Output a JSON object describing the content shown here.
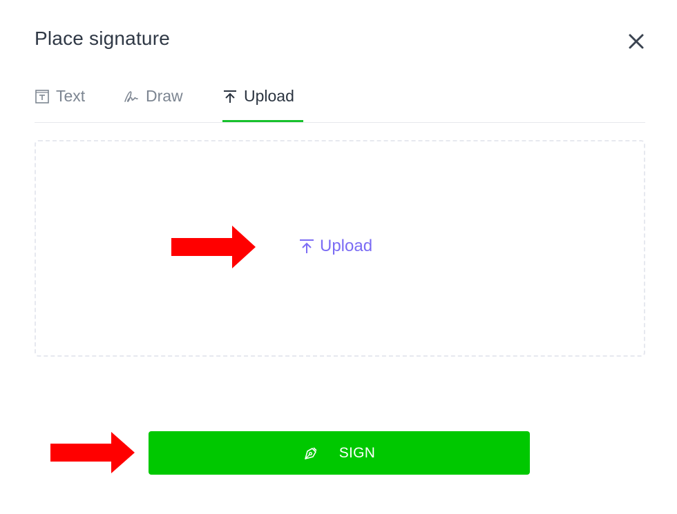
{
  "dialog": {
    "title": "Place signature",
    "close_label": "×"
  },
  "tabs": [
    {
      "label": "Text",
      "icon": "text-box-icon",
      "active": false
    },
    {
      "label": "Draw",
      "icon": "signature-pen-icon",
      "active": false
    },
    {
      "label": "Upload",
      "icon": "upload-icon",
      "active": true
    }
  ],
  "dropzone": {
    "upload_label": "Upload",
    "icon": "upload-icon"
  },
  "sign_button": {
    "label": "SIGN",
    "icon": "pen-nib-icon"
  },
  "colors": {
    "accent_green": "#00c800",
    "tab_underline": "#17c12b",
    "upload_link": "#7b6cf4",
    "annotation_arrow": "#ff0000"
  }
}
